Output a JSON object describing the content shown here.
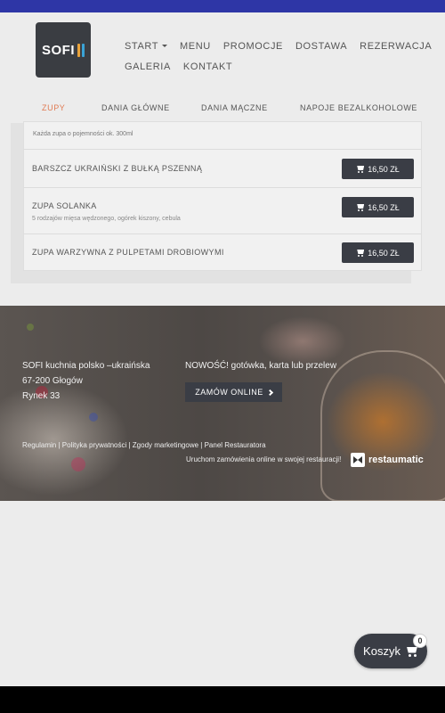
{
  "brand": {
    "logo_text": "SOFI"
  },
  "nav": {
    "row1": [
      "START",
      "MENU",
      "PROMOCJE",
      "DOSTAWA",
      "REZERWACJA"
    ],
    "row2": [
      "GALERIA",
      "KONTAKT"
    ]
  },
  "tabs": [
    "ZUPY",
    "DANIA GŁÓWNE",
    "DANIA MĄCZNE",
    "NAPOJE BEZALKOHOLOWE"
  ],
  "active_tab": "ZUPY",
  "menu": {
    "note": "Każda zupa o pojemności ok. 300ml",
    "items": [
      {
        "name": "BARSZCZ UKRAIŃSKI Z BUŁKĄ PSZENNĄ",
        "desc": "",
        "price": "16,50 ZŁ"
      },
      {
        "name": "ZUPA SOLANKA",
        "desc": "5 rodzajów mięsa wędzonego, ogórek kiszony, cebula",
        "price": "16,50 ZŁ"
      },
      {
        "name": "ZUPA WARZYWNA Z PULPETAMI DROBIOWYMI",
        "desc": "",
        "price": "16,50 ZŁ"
      }
    ]
  },
  "footer": {
    "address": [
      "SOFI kuchnia polsko –ukraińska",
      "67-200 Głogów",
      "Rynek 33"
    ],
    "news": "NOWOŚĆ! gotówka, karta lub przelew",
    "order_button": "ZAMÓW ONLINE",
    "links": [
      "Regulamin",
      "Polityka prywatności",
      "Zgody marketingowe",
      "Panel Restauratora"
    ],
    "powered_text": "Uruchom zamówienia online w swojej restauracji!",
    "powered_brand": "restaumatic"
  },
  "cart": {
    "label": "Koszyk",
    "count": "0"
  },
  "colors": {
    "topbar": "#2e36a6",
    "button": "#3a3d45",
    "active_tab": "#e07a52",
    "background": "#ececec"
  }
}
